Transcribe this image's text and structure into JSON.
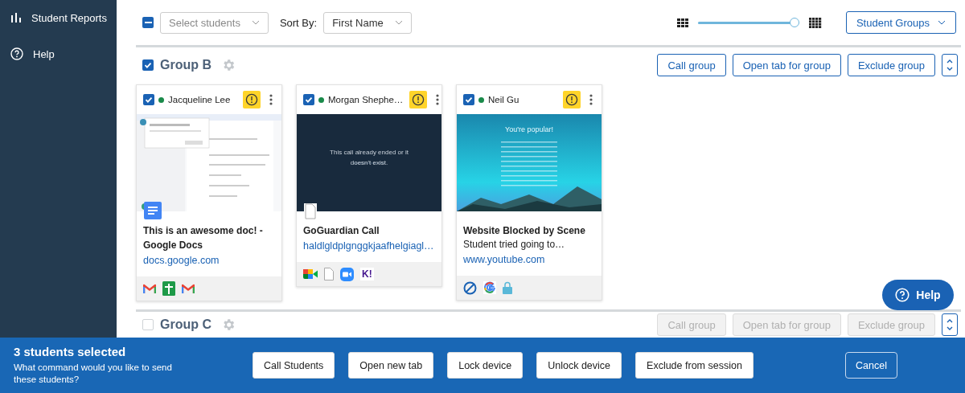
{
  "sidebar": {
    "items": [
      {
        "kind": "reports",
        "label": "Student Reports"
      },
      {
        "kind": "help",
        "label": "Help"
      }
    ]
  },
  "toolbar": {
    "select_all": {
      "indeterminate": true
    },
    "select_students": {
      "placeholder": "Select students"
    },
    "sort_label": "Sort By:",
    "sort_value": "First Name",
    "zoom_slider": {
      "level": 0.95
    },
    "groups_button": "Student Groups"
  },
  "groups": [
    {
      "name": "Group B",
      "checked": true,
      "disabled": false,
      "buttons": [
        "Call group",
        "Open tab for group",
        "Exclude group"
      ],
      "students": [
        {
          "name": "Jacqueline Lee",
          "checked": true,
          "online": true,
          "alert": true,
          "thumbnail": {
            "kind": "doc"
          },
          "tab_icon": {
            "kind": "docs"
          },
          "tab_title": "This is an awesome doc! - Google Docs",
          "url": "docs.google.com",
          "favicons": [
            {
              "kind": "gmail"
            },
            {
              "kind": "sheets"
            },
            {
              "kind": "gmail"
            }
          ]
        },
        {
          "name": "Morgan Shephe…",
          "checked": true,
          "online": true,
          "alert": true,
          "thumbnail": {
            "kind": "call",
            "text": "This call already ended or it doesn't exist."
          },
          "tab_icon": {
            "kind": "file"
          },
          "tab_title": "GoGuardian Call",
          "url": "haldlgldplgnggkjaafhelgiagl…",
          "favicons": [
            {
              "kind": "meet"
            },
            {
              "kind": "file"
            },
            {
              "kind": "zoom"
            },
            {
              "kind": "kahoot",
              "text": "K!"
            }
          ]
        },
        {
          "name": "Neil Gu",
          "checked": true,
          "online": true,
          "alert": true,
          "thumbnail": {
            "kind": "blocked",
            "text": "You're popular!"
          },
          "tab_title": "Website Blocked by Scene",
          "tab_subtitle": "Student tried going to…",
          "url": "www.youtube.com",
          "favicons": [
            {
              "kind": "block"
            },
            {
              "kind": "google"
            },
            {
              "kind": "lock"
            }
          ]
        }
      ]
    },
    {
      "name": "Group C",
      "checked": false,
      "disabled": true,
      "buttons": [
        "Call group",
        "Open tab for group",
        "Exclude group"
      ]
    }
  ],
  "help_button": "Help",
  "bottom_bar": {
    "title": "3 students selected",
    "prompt": "What command would you like to send these students?",
    "actions": [
      "Call Students",
      "Open new tab",
      "Lock device",
      "Unlock device",
      "Exclude from session"
    ],
    "cancel": "Cancel"
  }
}
